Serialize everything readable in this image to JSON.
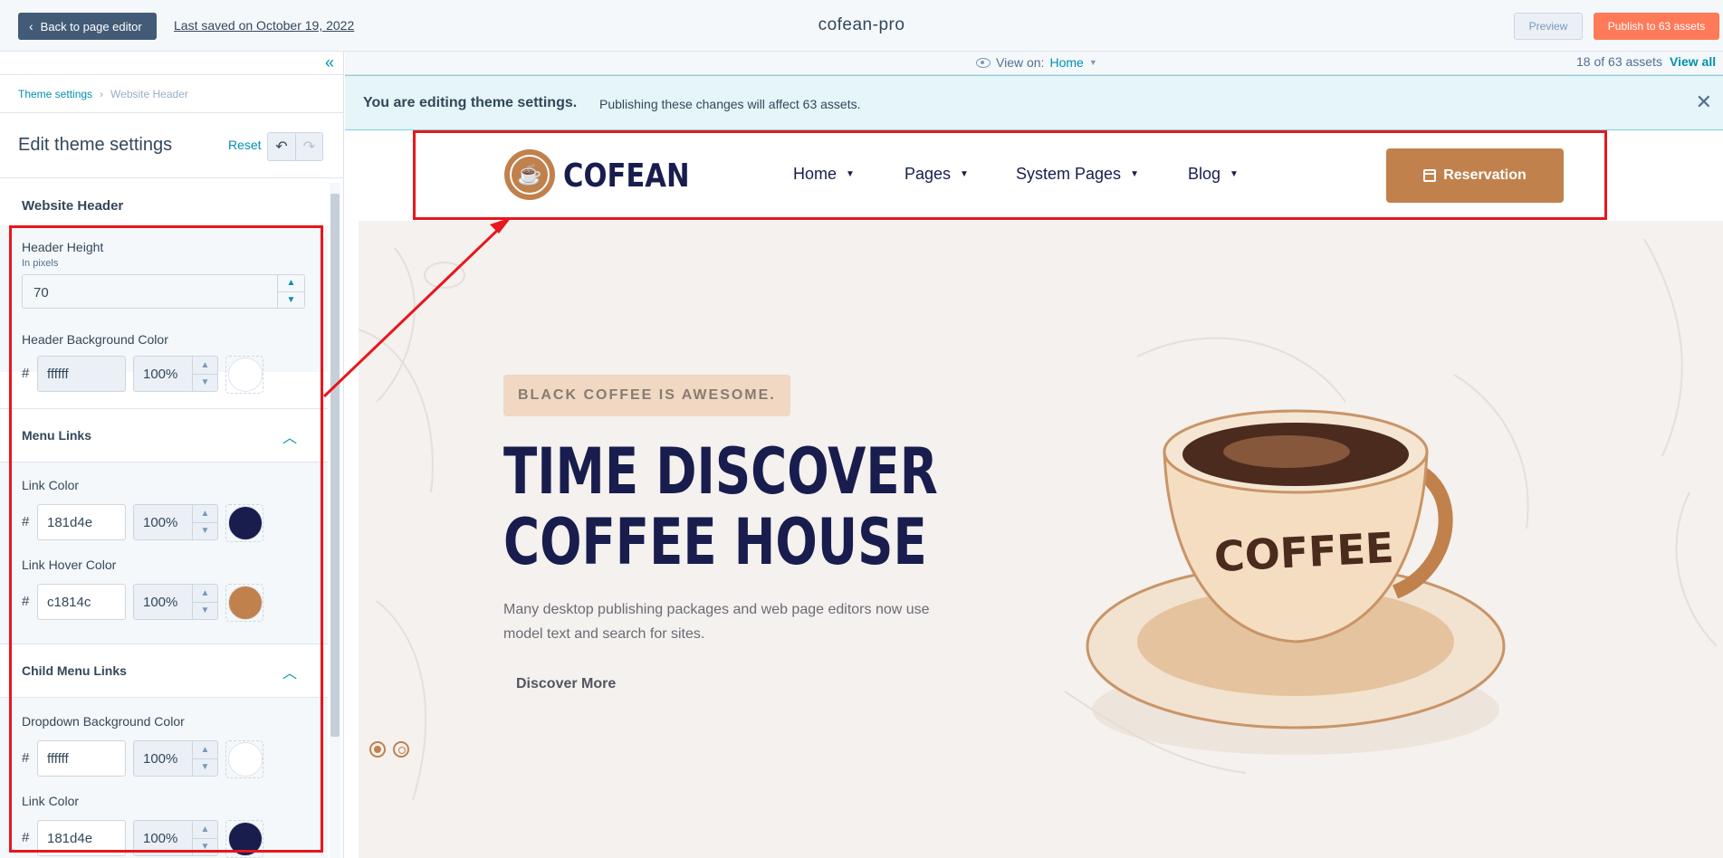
{
  "topbar": {
    "back_label": "Back to page editor",
    "last_saved": "Last saved on October 19, 2022",
    "site_name": "cofean-pro",
    "preview_label": "Preview",
    "publish_label": "Publish to 63 assets"
  },
  "sidebar": {
    "breadcrumb": [
      "Theme settings",
      "Website Header"
    ],
    "title": "Edit theme settings",
    "reset_label": "Reset",
    "section_title": "Website Header",
    "header_height": {
      "label": "Header Height",
      "help": "In pixels",
      "value": "70"
    },
    "header_bg": {
      "label": "Header Background Color",
      "hex": "ffffff",
      "opacity": "100%",
      "color": "#ffffff"
    },
    "menu_links": {
      "title": "Menu Links",
      "link_color": {
        "label": "Link Color",
        "hex": "181d4e",
        "opacity": "100%",
        "color": "#181d4e"
      },
      "hover_color": {
        "label": "Link Hover Color",
        "hex": "c1814c",
        "opacity": "100%",
        "color": "#c1814c"
      }
    },
    "child_menu_links": {
      "title": "Child Menu Links",
      "dropdown_bg": {
        "label": "Dropdown Background Color",
        "hex": "ffffff",
        "opacity": "100%",
        "color": "#ffffff"
      },
      "link_color": {
        "label": "Link Color",
        "hex": "181d4e",
        "opacity": "100%",
        "color": "#181d4e"
      }
    }
  },
  "viewbar": {
    "view_on_label": "View on:",
    "view_on_value": "Home",
    "assets_count": "18 of 63 assets",
    "view_all": "View all"
  },
  "banner": {
    "strong": "You are editing theme settings.",
    "text": "Publishing these changes will affect 63 assets."
  },
  "site": {
    "logo_text": "COFEAN",
    "nav": [
      "Home",
      "Pages",
      "System Pages",
      "Blog"
    ],
    "reservation_label": "Reservation",
    "hero": {
      "tag": "BLACK COFFEE IS AWESOME.",
      "title_line1": "TIME DISCOVER",
      "title_line2": "COFFEE HOUSE",
      "description": "Many desktop publishing packages and web page editors now use model text and search for sites.",
      "cta": "Discover More",
      "cup_text": "COFFEE"
    }
  },
  "colors": {
    "accent": "#0091ae",
    "brand_brown": "#c1814c",
    "brand_navy": "#181d4e",
    "publish": "#ff7a59",
    "annotation_red": "#e8161d"
  }
}
